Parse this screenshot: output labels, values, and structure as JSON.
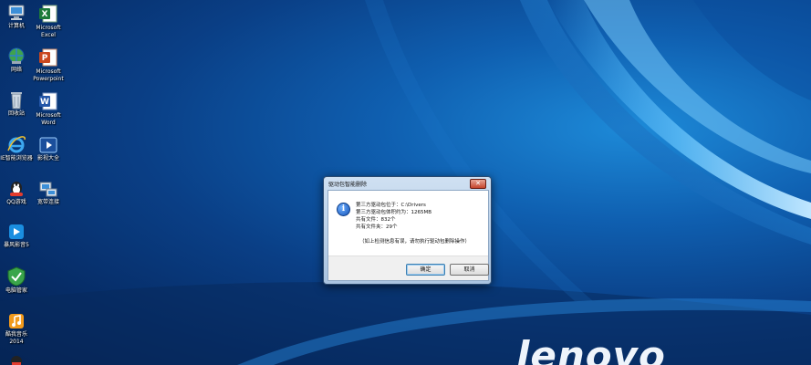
{
  "desktop": {
    "icons": [
      {
        "label": "计算机",
        "icon": "computer-icon"
      },
      {
        "label": "Microsoft\nExcel",
        "icon": "excel-icon"
      },
      {
        "label": "网络",
        "icon": "network-icon"
      },
      {
        "label": "Microsoft\nPowerpoint",
        "icon": "powerpoint-icon"
      },
      {
        "label": "回收站",
        "icon": "recycle-bin-icon"
      },
      {
        "label": "Microsoft\nWord",
        "icon": "word-icon"
      },
      {
        "label": "IE智能浏览器",
        "icon": "ie-browser-icon"
      },
      {
        "label": "影视大全",
        "icon": "video-icon"
      },
      {
        "label": "QQ游戏",
        "icon": "qq-game-icon"
      },
      {
        "label": "宽带连接",
        "icon": "broadband-icon"
      },
      {
        "label": "暴风影音5",
        "icon": "storm-player-icon"
      },
      {
        "label": "电脑管家",
        "icon": "pc-manager-icon"
      },
      {
        "label": "酷我音乐\n2014",
        "icon": "kuwo-music-icon"
      },
      {
        "label": "",
        "icon": "qq-icon"
      }
    ],
    "brand": "lenovo"
  },
  "dialog": {
    "title": "驱动包智能删除",
    "close_label": "✕",
    "info_glyph": "i",
    "lines": [
      "第三方驱动包位于：C:\\Drivers",
      "第三方驱动包体积约为：1265MB",
      "共有文件：832个",
      "共有文件夹：29个",
      "（如上检测信息有误，请勿执行驱动包删除操作）"
    ],
    "ok_label": "确定",
    "cancel_label": "取消"
  }
}
